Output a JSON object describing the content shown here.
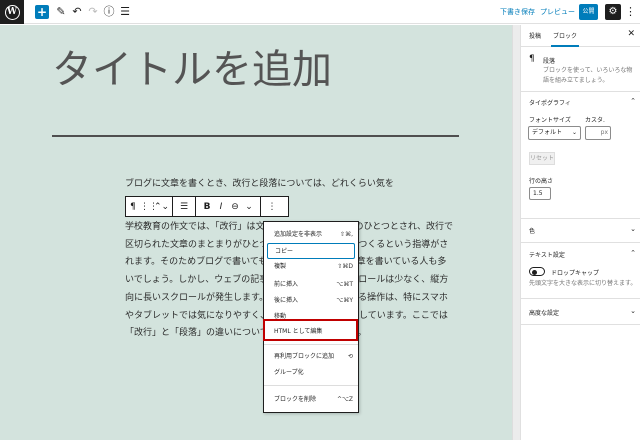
{
  "topbar": {
    "wp_logo": "W",
    "icons": [
      "plus-icon",
      "pencil-icon",
      "undo-icon",
      "redo-icon",
      "info-icon",
      "list-view-icon"
    ],
    "save_draft": "下書き保存",
    "preview": "プレビュー",
    "publish": "公開",
    "settings": "⚙",
    "more": "⋮"
  },
  "editor": {
    "title": "タイトルを追加",
    "para1": "ブログに文章を書くとき、改行と段落については、どれくらい気を",
    "para2": "学校教育の作文では、「改行」は文章の区切りを示す処理のひとつとされ、改行で区切られた文章のまとまりがひとつの意味上のまとまりをつくるという指導がされます。そのためブログで書いても、その記法に従って文章を書いている人も多いでしょう。しかし、ウェブの記事では横方向に長いスクロールは少なく、縦方向に長いスクロールが発生します。短い文章を繰り返し送る操作は、特にスマホやタブレットでは気になりやすく、独特のリズムを生み出しています。ここでは「改行」と「段落」の違いについて、確認してみましょう。"
  },
  "block_toolbar": {
    "items": [
      "¶",
      "⋮⋮",
      "⌃⌄",
      "☰",
      "B",
      "I",
      "⊖",
      "⌄",
      "⋮"
    ]
  },
  "menu": {
    "items": [
      {
        "label": "追加設定を非表示",
        "shortcut": "⇧⌘,"
      },
      {
        "label": "コピー",
        "shortcut": ""
      },
      {
        "label": "複製",
        "shortcut": "⇧⌘D"
      },
      {
        "label": "前に挿入",
        "shortcut": "⌥⌘T"
      },
      {
        "label": "後に挿入",
        "shortcut": "⌥⌘Y"
      },
      {
        "label": "移動",
        "shortcut": ""
      },
      {
        "label": "HTML として編集",
        "shortcut": ""
      },
      {
        "label": "再利用ブロックに追加",
        "shortcut": "⟲"
      },
      {
        "label": "グループ化",
        "shortcut": ""
      },
      {
        "label": "ブロックを削除",
        "shortcut": "^⌥Z"
      }
    ],
    "highlight_color": "#c00000"
  },
  "sidebar": {
    "tab_post": "投稿",
    "tab_block": "ブロック",
    "close": "✕",
    "block_icon": "¶",
    "block_name": "段落",
    "block_desc": "ブロックを使って、いろいろな物語を組み立てましょう。",
    "typography": "タイポグラフィ",
    "font_size_label": "フォントサイズ",
    "custom_label": "カスタ.",
    "font_size_value": "デフォルト",
    "custom_unit": "px",
    "reset": "リセット",
    "line_height_label": "行の高さ",
    "line_height_value": "1.5",
    "color": "色",
    "text_settings": "テキスト設定",
    "drop_cap": "ドロップキャップ",
    "drop_cap_desc": "先頭文字を大きな表示に切り替えます。",
    "advanced": "高度な設定"
  }
}
